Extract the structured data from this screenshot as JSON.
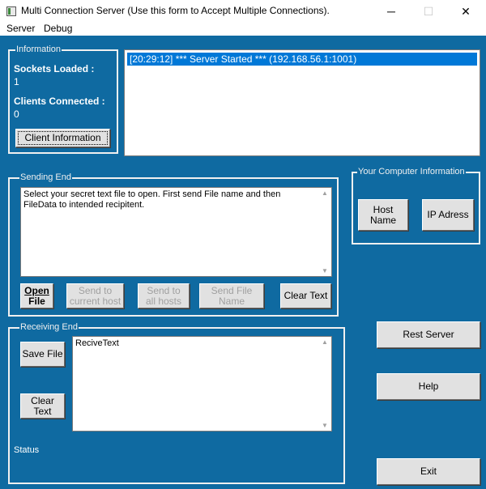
{
  "window": {
    "title": "Multi Connection Server (Use this form to Accept Multiple Connections).",
    "minimize": "─",
    "maximize": "☐",
    "close": "✕"
  },
  "menu": {
    "server": "Server",
    "debug": "Debug"
  },
  "information": {
    "legend": "Information",
    "sockets_label": "Sockets Loaded :",
    "sockets_value": "1",
    "clients_label": "Clients Connected :",
    "clients_value": "0",
    "client_info_button": "Client Information"
  },
  "log": {
    "lines": [
      "[20:29:12] *** Server Started *** (192.168.56.1:1001)"
    ]
  },
  "sending": {
    "legend": "Sending End",
    "text": "Select your secret text file to open. First send File name and then FileData to intended recipitent.",
    "open_file_1": "Open",
    "open_file_2": "File",
    "send_current_1": "Send to",
    "send_current_2": "current host",
    "send_all_1": "Send to",
    "send_all_2": "all  hosts",
    "send_file_name": "Send File Name",
    "clear_text": "Clear Text"
  },
  "receiving": {
    "legend": "Receiving End",
    "save_file": "Save File",
    "clear_text": "Clear Text",
    "text": "ReciveText"
  },
  "status": "Status",
  "computer_info": {
    "legend": "Your Computer Information",
    "host_name": "Host Name",
    "ip_address": "IP Adress"
  },
  "buttons": {
    "rest_server": "Rest Server",
    "help": "Help",
    "exit": "Exit"
  },
  "colors": {
    "background": "#0f6aa1",
    "selection": "#0078d7",
    "button_face": "#e1e1e1"
  }
}
